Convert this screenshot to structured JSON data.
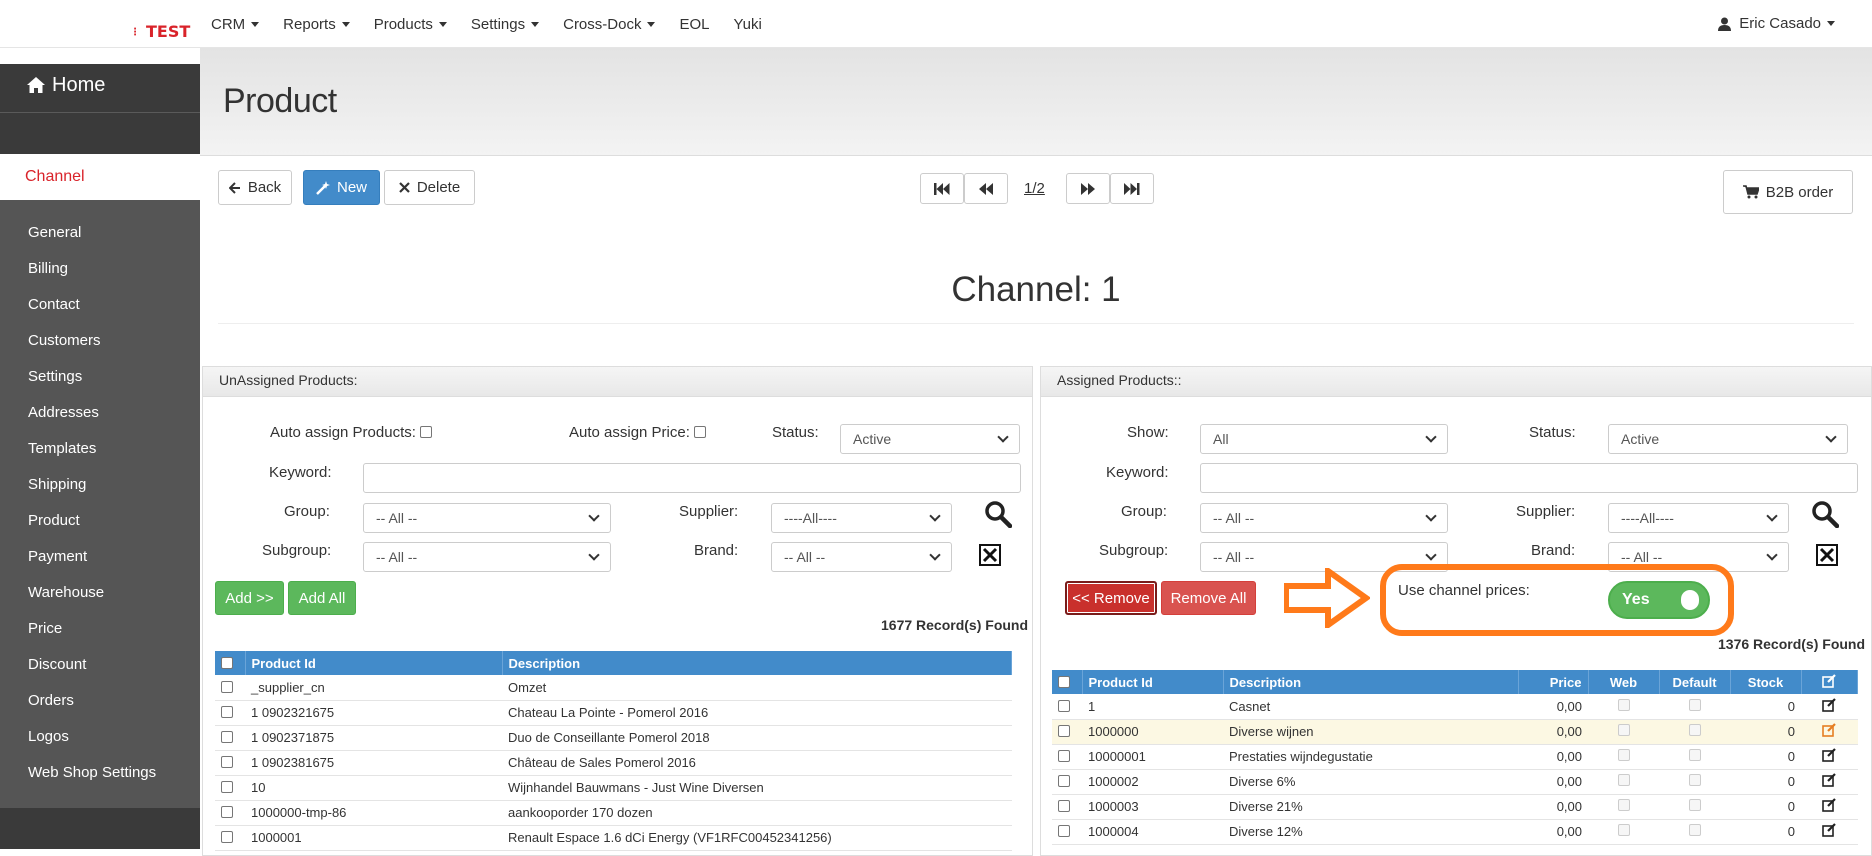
{
  "logo": {
    "text": "TEST",
    "dots": "⋮"
  },
  "nav": [
    {
      "label": "CRM",
      "dropdown": true
    },
    {
      "label": "Reports",
      "dropdown": true
    },
    {
      "label": "Products",
      "dropdown": true
    },
    {
      "label": "Settings",
      "dropdown": true
    },
    {
      "label": "Cross-Dock",
      "dropdown": true
    },
    {
      "label": "EOL",
      "dropdown": false
    },
    {
      "label": "Yuki",
      "dropdown": false
    }
  ],
  "user": {
    "name": "Eric Casado"
  },
  "sidebar": {
    "home": "Home",
    "active": "Channel",
    "items": [
      "General",
      "Billing",
      "Contact",
      "Customers",
      "Settings",
      "Addresses",
      "Templates",
      "Shipping",
      "Product",
      "Payment",
      "Warehouse",
      "Price",
      "Discount",
      "Orders",
      "Logos",
      "Web Shop Settings"
    ]
  },
  "page": {
    "title": "Product"
  },
  "toolbar": {
    "back": "Back",
    "new": "New",
    "delete": "Delete",
    "page": "1/2",
    "b2b": "B2B order"
  },
  "heading": "Channel: 1",
  "unassigned": {
    "title": "UnAssigned Products:",
    "auto_assign_products": "Auto assign Products:",
    "auto_assign_price": "Auto assign Price:",
    "status_label": "Status:",
    "status_value": "Active",
    "keyword_label": "Keyword:",
    "group_label": "Group:",
    "group_value": "-- All --",
    "supplier_label": "Supplier:",
    "supplier_value": "----All----",
    "subgroup_label": "Subgroup:",
    "subgroup_value": "-- All --",
    "brand_label": "Brand:",
    "brand_value": "-- All --",
    "add": "Add >>",
    "add_all": "Add All",
    "records": "1677 Record(s) Found",
    "columns": [
      "Product Id",
      "Description"
    ],
    "rows": [
      [
        "_supplier_cn",
        "Omzet"
      ],
      [
        "1 0902321675",
        "Chateau La Pointe - Pomerol 2016"
      ],
      [
        "1 0902371875",
        "Duo de Conseillante Pomerol 2018"
      ],
      [
        "1 0902381675",
        "Château de Sales Pomerol 2016"
      ],
      [
        "10",
        "Wijnhandel Bauwmans - Just Wine Diversen"
      ],
      [
        "1000000-tmp-86",
        "aankooporder 170 dozen"
      ],
      [
        "1000001",
        "Renault Espace 1.6 dCi Energy (VF1RFC00452341256)"
      ]
    ]
  },
  "assigned": {
    "title": "Assigned Products::",
    "show_label": "Show:",
    "show_value": "All",
    "status_label": "Status:",
    "status_value": "Active",
    "keyword_label": "Keyword:",
    "group_label": "Group:",
    "group_value": "-- All --",
    "supplier_label": "Supplier:",
    "supplier_value": "----All----",
    "subgroup_label": "Subgroup:",
    "subgroup_value": "-- All --",
    "brand_label": "Brand:",
    "brand_value": "-- All --",
    "remove": "<< Remove",
    "remove_all": "Remove All",
    "use_channel_prices": "Use channel prices:",
    "toggle": "Yes",
    "records": "1376 Record(s) Found",
    "columns": [
      "Product Id",
      "Description",
      "Price",
      "Web",
      "Default",
      "Stock"
    ],
    "rows": [
      {
        "id": "1",
        "desc": "Casnet",
        "price": "0,00",
        "stock": "0"
      },
      {
        "id": "1000000",
        "desc": "Diverse wijnen",
        "price": "0,00",
        "stock": "0"
      },
      {
        "id": "10000001",
        "desc": "Prestaties wijndegustatie",
        "price": "0,00",
        "stock": "0"
      },
      {
        "id": "1000002",
        "desc": "Diverse 6%",
        "price": "0,00",
        "stock": "0"
      },
      {
        "id": "1000003",
        "desc": "Diverse 21%",
        "price": "0,00",
        "stock": "0"
      },
      {
        "id": "1000004",
        "desc": "Diverse 12%",
        "price": "0,00",
        "stock": "0"
      }
    ]
  },
  "colors": {
    "accent_red": "#d9232a",
    "primary_blue": "#428bca",
    "success_green": "#5cb85c",
    "danger_red": "#d9534f",
    "highlight_orange": "#ff7a1a"
  }
}
